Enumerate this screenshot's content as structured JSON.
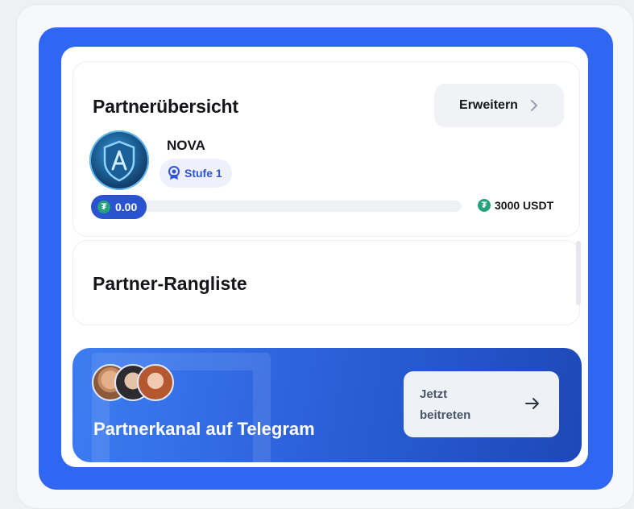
{
  "overview": {
    "title": "Partnerübersicht",
    "expand_label": "Erweitern",
    "partner_name": "NOVA",
    "level_label": "Stufe 1",
    "progress": {
      "current": "0.00",
      "target": "3000 USDT",
      "fraction": 0.0,
      "currency_icon": "tether-icon"
    }
  },
  "ranking": {
    "title": "Partner-Rangliste"
  },
  "telegram_banner": {
    "text": "Partnerkanal auf Telegram",
    "join_label": "Jetzt beitreten"
  },
  "colors": {
    "frame_blue": "#2f66f2",
    "progress_blue": "#2a53d0",
    "tether_green": "#26a17b",
    "level_text": "#2d55d6"
  }
}
